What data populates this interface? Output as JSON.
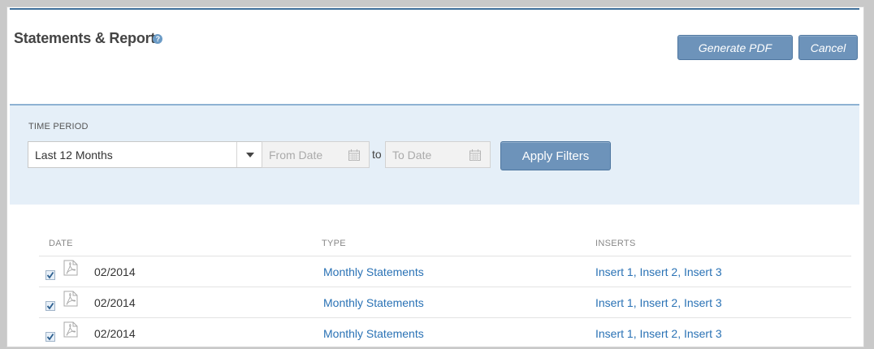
{
  "header": {
    "title": "Statements & Report",
    "help_icon": "?",
    "generate_pdf_label": "Generate PDF",
    "cancel_label": "Cancel"
  },
  "filters": {
    "time_period_label": "TIME PERIOD",
    "time_period_value": "Last 12 Months",
    "from_date_placeholder": "From Date",
    "to_separator": "to",
    "to_date_placeholder": "To Date",
    "apply_label": "Apply Filters"
  },
  "table": {
    "headers": {
      "date": "DATE",
      "type": "TYPE",
      "inserts": "INSERTS"
    },
    "rows": [
      {
        "checked": true,
        "date": "02/2014",
        "type": "Monthly Statements",
        "inserts": [
          "Insert 1",
          "Insert 2",
          "Insert 3"
        ]
      },
      {
        "checked": true,
        "date": "02/2014",
        "type": "Monthly Statements",
        "inserts": [
          "Insert 1",
          "Insert 2",
          "Insert 3"
        ]
      },
      {
        "checked": true,
        "date": "02/2014",
        "type": "Monthly Statements",
        "inserts": [
          "Insert 1",
          "Insert 2",
          "Insert 3"
        ]
      }
    ]
  },
  "colors": {
    "accent": "#6d93ba",
    "link": "#2a72b5",
    "panel": "#e5eff8"
  },
  "icons": {
    "help": "question-icon",
    "calendar": "calendar-icon",
    "pdf": "pdf-icon",
    "dropdown": "chevron-down-icon"
  }
}
